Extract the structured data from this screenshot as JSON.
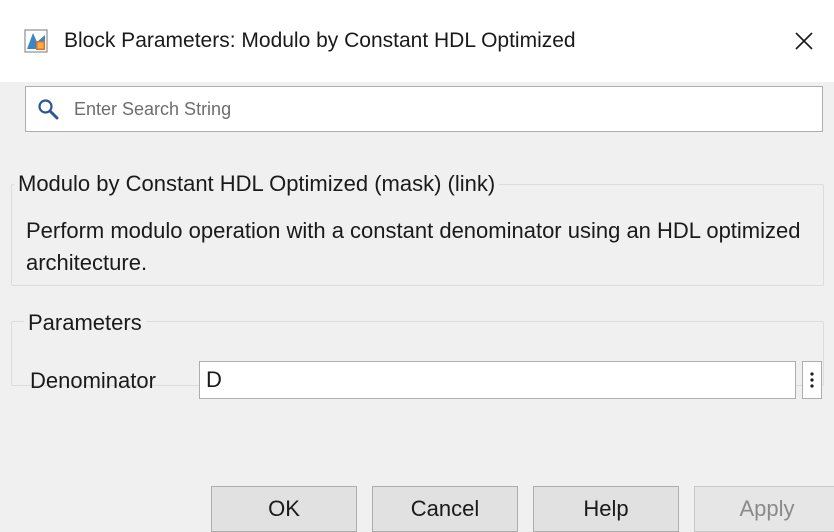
{
  "window": {
    "title": "Block Parameters: Modulo by Constant HDL Optimized",
    "app_icon": "simulink-block-icon",
    "close_icon": "close-icon"
  },
  "search": {
    "placeholder": "Enter Search String",
    "value": "",
    "icon": "search-icon"
  },
  "description": {
    "group_title": "Modulo by Constant HDL Optimized (mask) (link)",
    "text": "Perform modulo operation with a constant denominator using an HDL optimized architecture."
  },
  "parameters": {
    "group_title": "Parameters",
    "denominator_label": "Denominator",
    "denominator_value": "D",
    "more_icon": "vertical-ellipsis-icon"
  },
  "buttons": {
    "ok": "OK",
    "cancel": "Cancel",
    "help": "Help",
    "apply": "Apply",
    "apply_enabled": false
  },
  "colors": {
    "window_bg": "#f0f0f0",
    "titlebar_bg": "#ffffff",
    "search_icon": "#2b5797",
    "disabled_text": "#8a8a8a"
  }
}
